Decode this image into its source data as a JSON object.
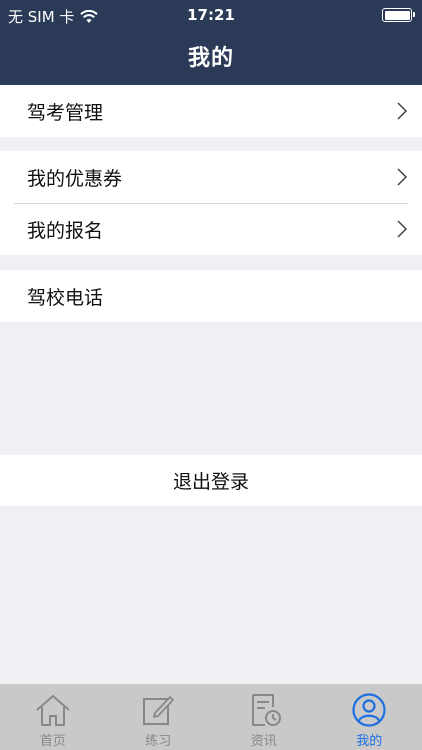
{
  "status_bar": {
    "carrier": "无 SIM 卡",
    "wifi_icon": "wifi-icon",
    "time": "17:21",
    "battery_icon": "battery-icon"
  },
  "nav": {
    "title": "我的"
  },
  "groups": [
    {
      "items": [
        {
          "label": "驾考管理",
          "icon": "chevron-right-icon"
        }
      ]
    },
    {
      "items": [
        {
          "label": "我的优惠券",
          "icon": "chevron-right-icon"
        },
        {
          "label": "我的报名",
          "icon": "chevron-right-icon"
        }
      ]
    },
    {
      "items": [
        {
          "label": "驾校电话"
        }
      ]
    }
  ],
  "logout": {
    "label": "退出登录"
  },
  "tabbar": {
    "active_color": "#1e6fe0",
    "inactive_color": "#888888",
    "tabs": [
      {
        "label": "首页",
        "icon": "home-icon"
      },
      {
        "label": "练习",
        "icon": "edit-icon"
      },
      {
        "label": "资讯",
        "icon": "news-icon"
      },
      {
        "label": "我的",
        "icon": "user-icon",
        "active": true
      }
    ]
  }
}
